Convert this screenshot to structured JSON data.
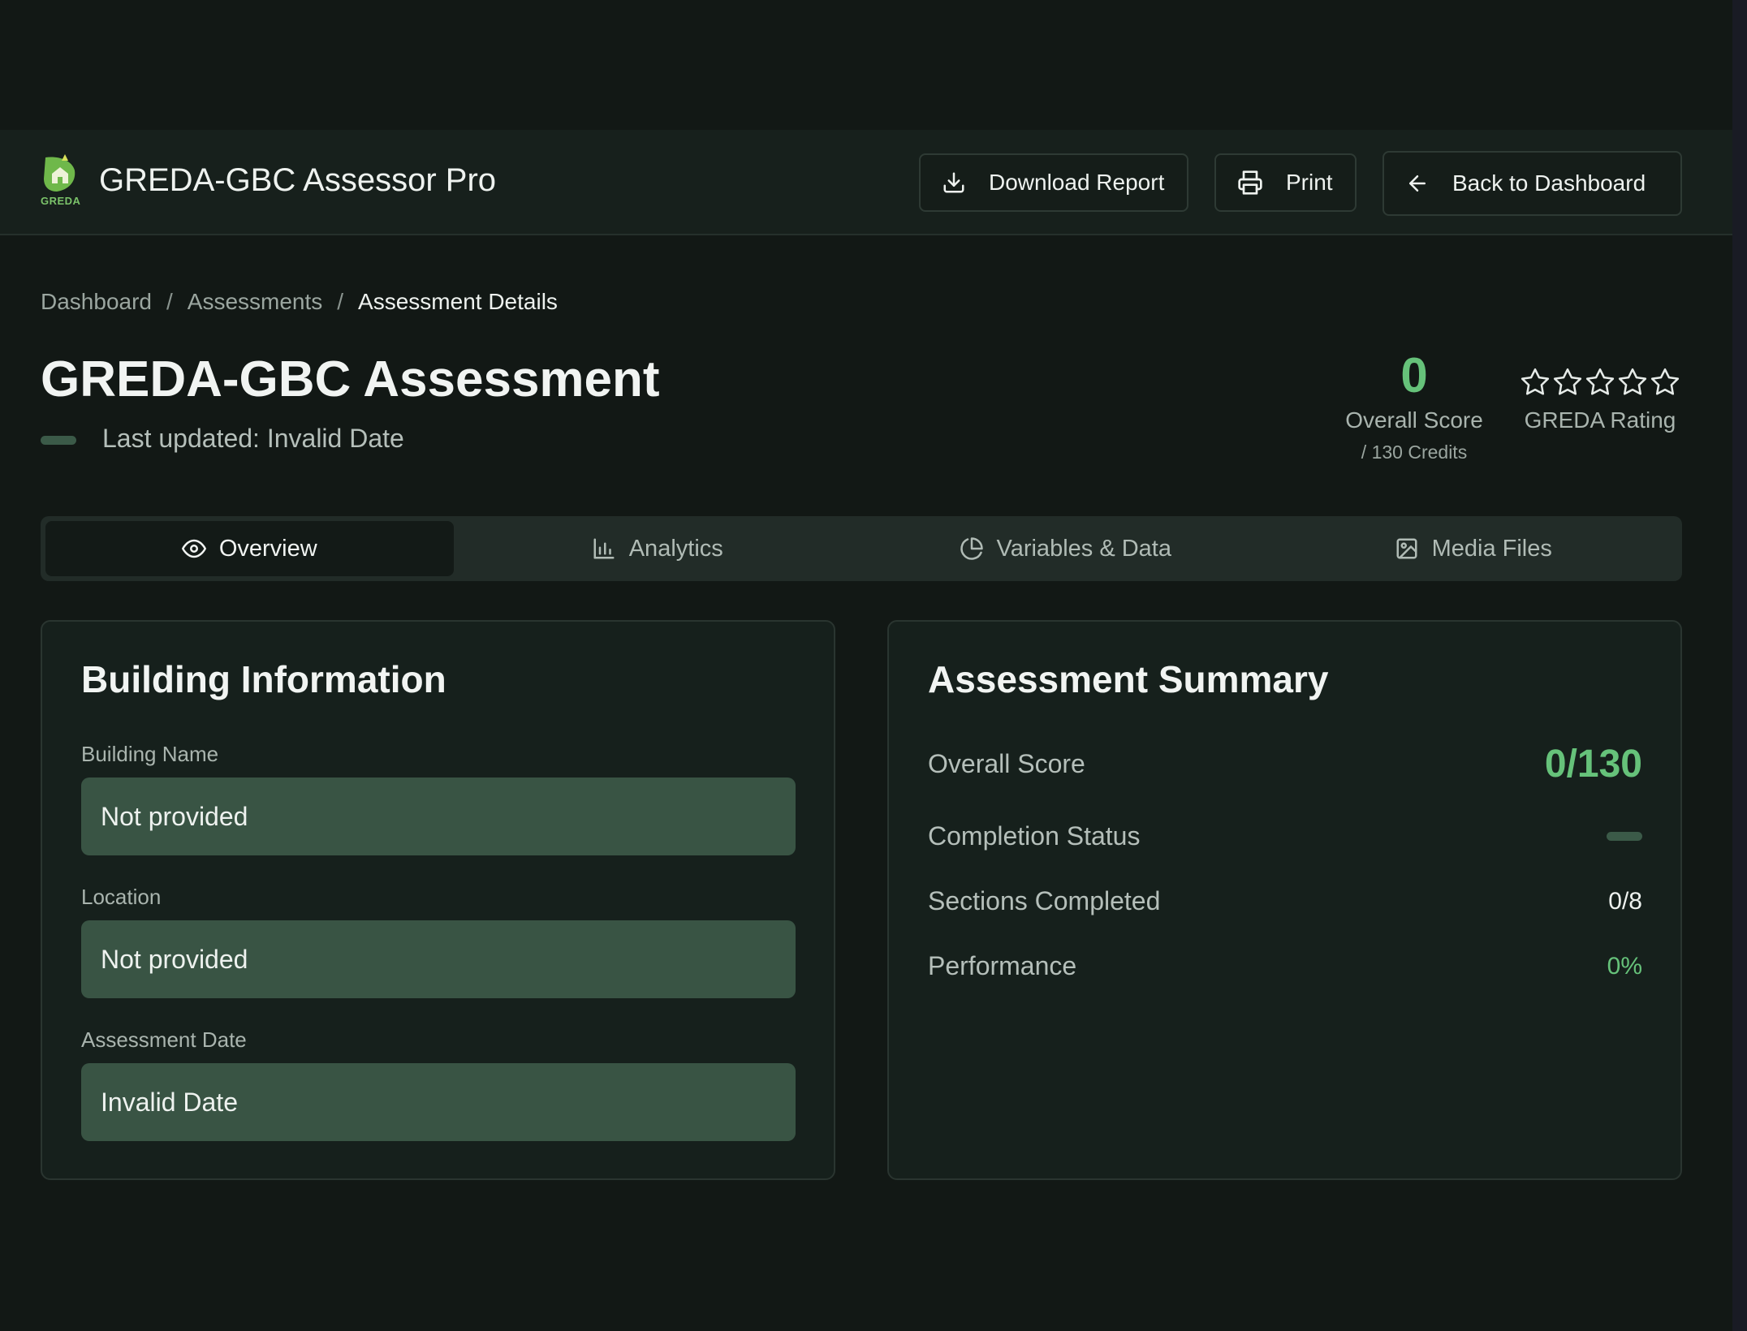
{
  "header": {
    "app_title": "GREDA-GBC Assessor Pro",
    "logo_text": "GREDA",
    "buttons": {
      "download": "Download Report",
      "print": "Print",
      "back": "Back to Dashboard"
    }
  },
  "breadcrumb": {
    "items": [
      "Dashboard",
      "Assessments"
    ],
    "current": "Assessment Details",
    "separator": "/"
  },
  "page": {
    "title": "GREDA-GBC Assessment",
    "last_updated": "Last updated: Invalid Date"
  },
  "score": {
    "value": "0",
    "label": "Overall Score",
    "sub": "/ 130 Credits"
  },
  "rating": {
    "label": "GREDA Rating",
    "stars_filled": 0,
    "stars_total": 5
  },
  "tabs": [
    {
      "label": "Overview",
      "icon": "eye-icon",
      "active": true
    },
    {
      "label": "Analytics",
      "icon": "bar-chart-icon",
      "active": false
    },
    {
      "label": "Variables & Data",
      "icon": "pie-chart-icon",
      "active": false
    },
    {
      "label": "Media Files",
      "icon": "image-icon",
      "active": false
    }
  ],
  "building_info": {
    "title": "Building Information",
    "fields": [
      {
        "label": "Building Name",
        "value": "Not provided"
      },
      {
        "label": "Location",
        "value": "Not provided"
      },
      {
        "label": "Assessment Date",
        "value": "Invalid Date"
      }
    ]
  },
  "summary": {
    "title": "Assessment Summary",
    "overall_score_label": "Overall Score",
    "overall_score_value": "0/130",
    "completion_label": "Completion Status",
    "sections_label": "Sections Completed",
    "sections_value": "0/8",
    "performance_label": "Performance",
    "performance_value": "0%"
  },
  "colors": {
    "accent_green": "#66c27a",
    "field_bg": "#395444",
    "background": "#121815"
  }
}
